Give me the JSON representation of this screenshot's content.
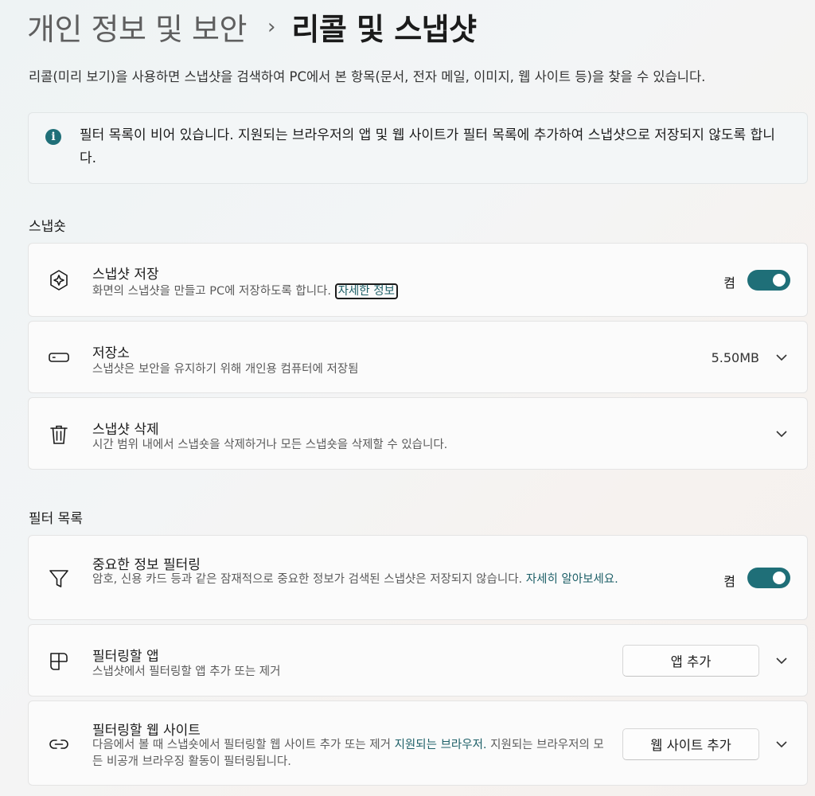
{
  "breadcrumb": {
    "parent": "개인 정보 및 보안",
    "separator": "›",
    "current": "리콜 및 스냅샷"
  },
  "description": "리콜(미리 보기)을 사용하면 스냅샷을 검색하여 PC에서 본 항목(문서, 전자 메일, 이미지, 웹 사이트 등)을 찾을 수 있습니다.",
  "infobar": {
    "icon": "info-icon",
    "text": "필터 목록이 비어 있습니다. 지원되는 브라우저의 앱 및 웹 사이트가 필터 목록에 추가하여 스냅샷으로 저장되지 않도록 합니다."
  },
  "sections": {
    "snapshots": "스냅숏",
    "filter_list": "필터 목록"
  },
  "save_snapshots": {
    "icon": "snapshot-icon",
    "title": "스냅샷 저장",
    "subtitle": "화면의 스냅샷을 만들고 PC에 저장하도록 합니다.",
    "link": "자세한 정보",
    "toggle_label": "켬",
    "toggle_on": true
  },
  "storage": {
    "icon": "storage-icon",
    "title": "저장소",
    "subtitle": "스냅샷은 보안을 유지하기 위해 개인용 컴퓨터에 저장됨",
    "value": "5.50MB"
  },
  "delete_snapshots": {
    "icon": "trash-icon",
    "title": "스냅샷 삭제",
    "subtitle": "시간 범위 내에서 스냅숏을 삭제하거나 모든 스냅숏을 삭제할 수 있습니다."
  },
  "sensitive_filter": {
    "icon": "filter-icon",
    "title": "중요한 정보 필터링",
    "subtitle": "암호, 신용 카드 등과 같은 잠재적으로 중요한 정보가 검색된 스냅샷은 저장되지 않습니다.",
    "link": "자세히 알아보세요.",
    "toggle_label": "켬",
    "toggle_on": true
  },
  "filter_apps": {
    "icon": "apps-icon",
    "title": "필터링할 앱",
    "subtitle": "스냅샷에서 필터링할 앱 추가 또는 제거",
    "button": "앱 추가"
  },
  "filter_websites": {
    "icon": "link-icon",
    "title": "필터링할 웹 사이트",
    "subtitle_before": "다음에서 볼 때 스냅숏에서 필터링할 웹 사이트 추가 또는 제거",
    "link": "지원되는 브라우저.",
    "subtitle_after": "지원되는 브라우저의 모든 비공개 브라우징 활동이 필터링됩니다.",
    "button": "웹 사이트 추가"
  },
  "colors": {
    "accent": "#1f6f78",
    "link": "#1d5f67"
  }
}
